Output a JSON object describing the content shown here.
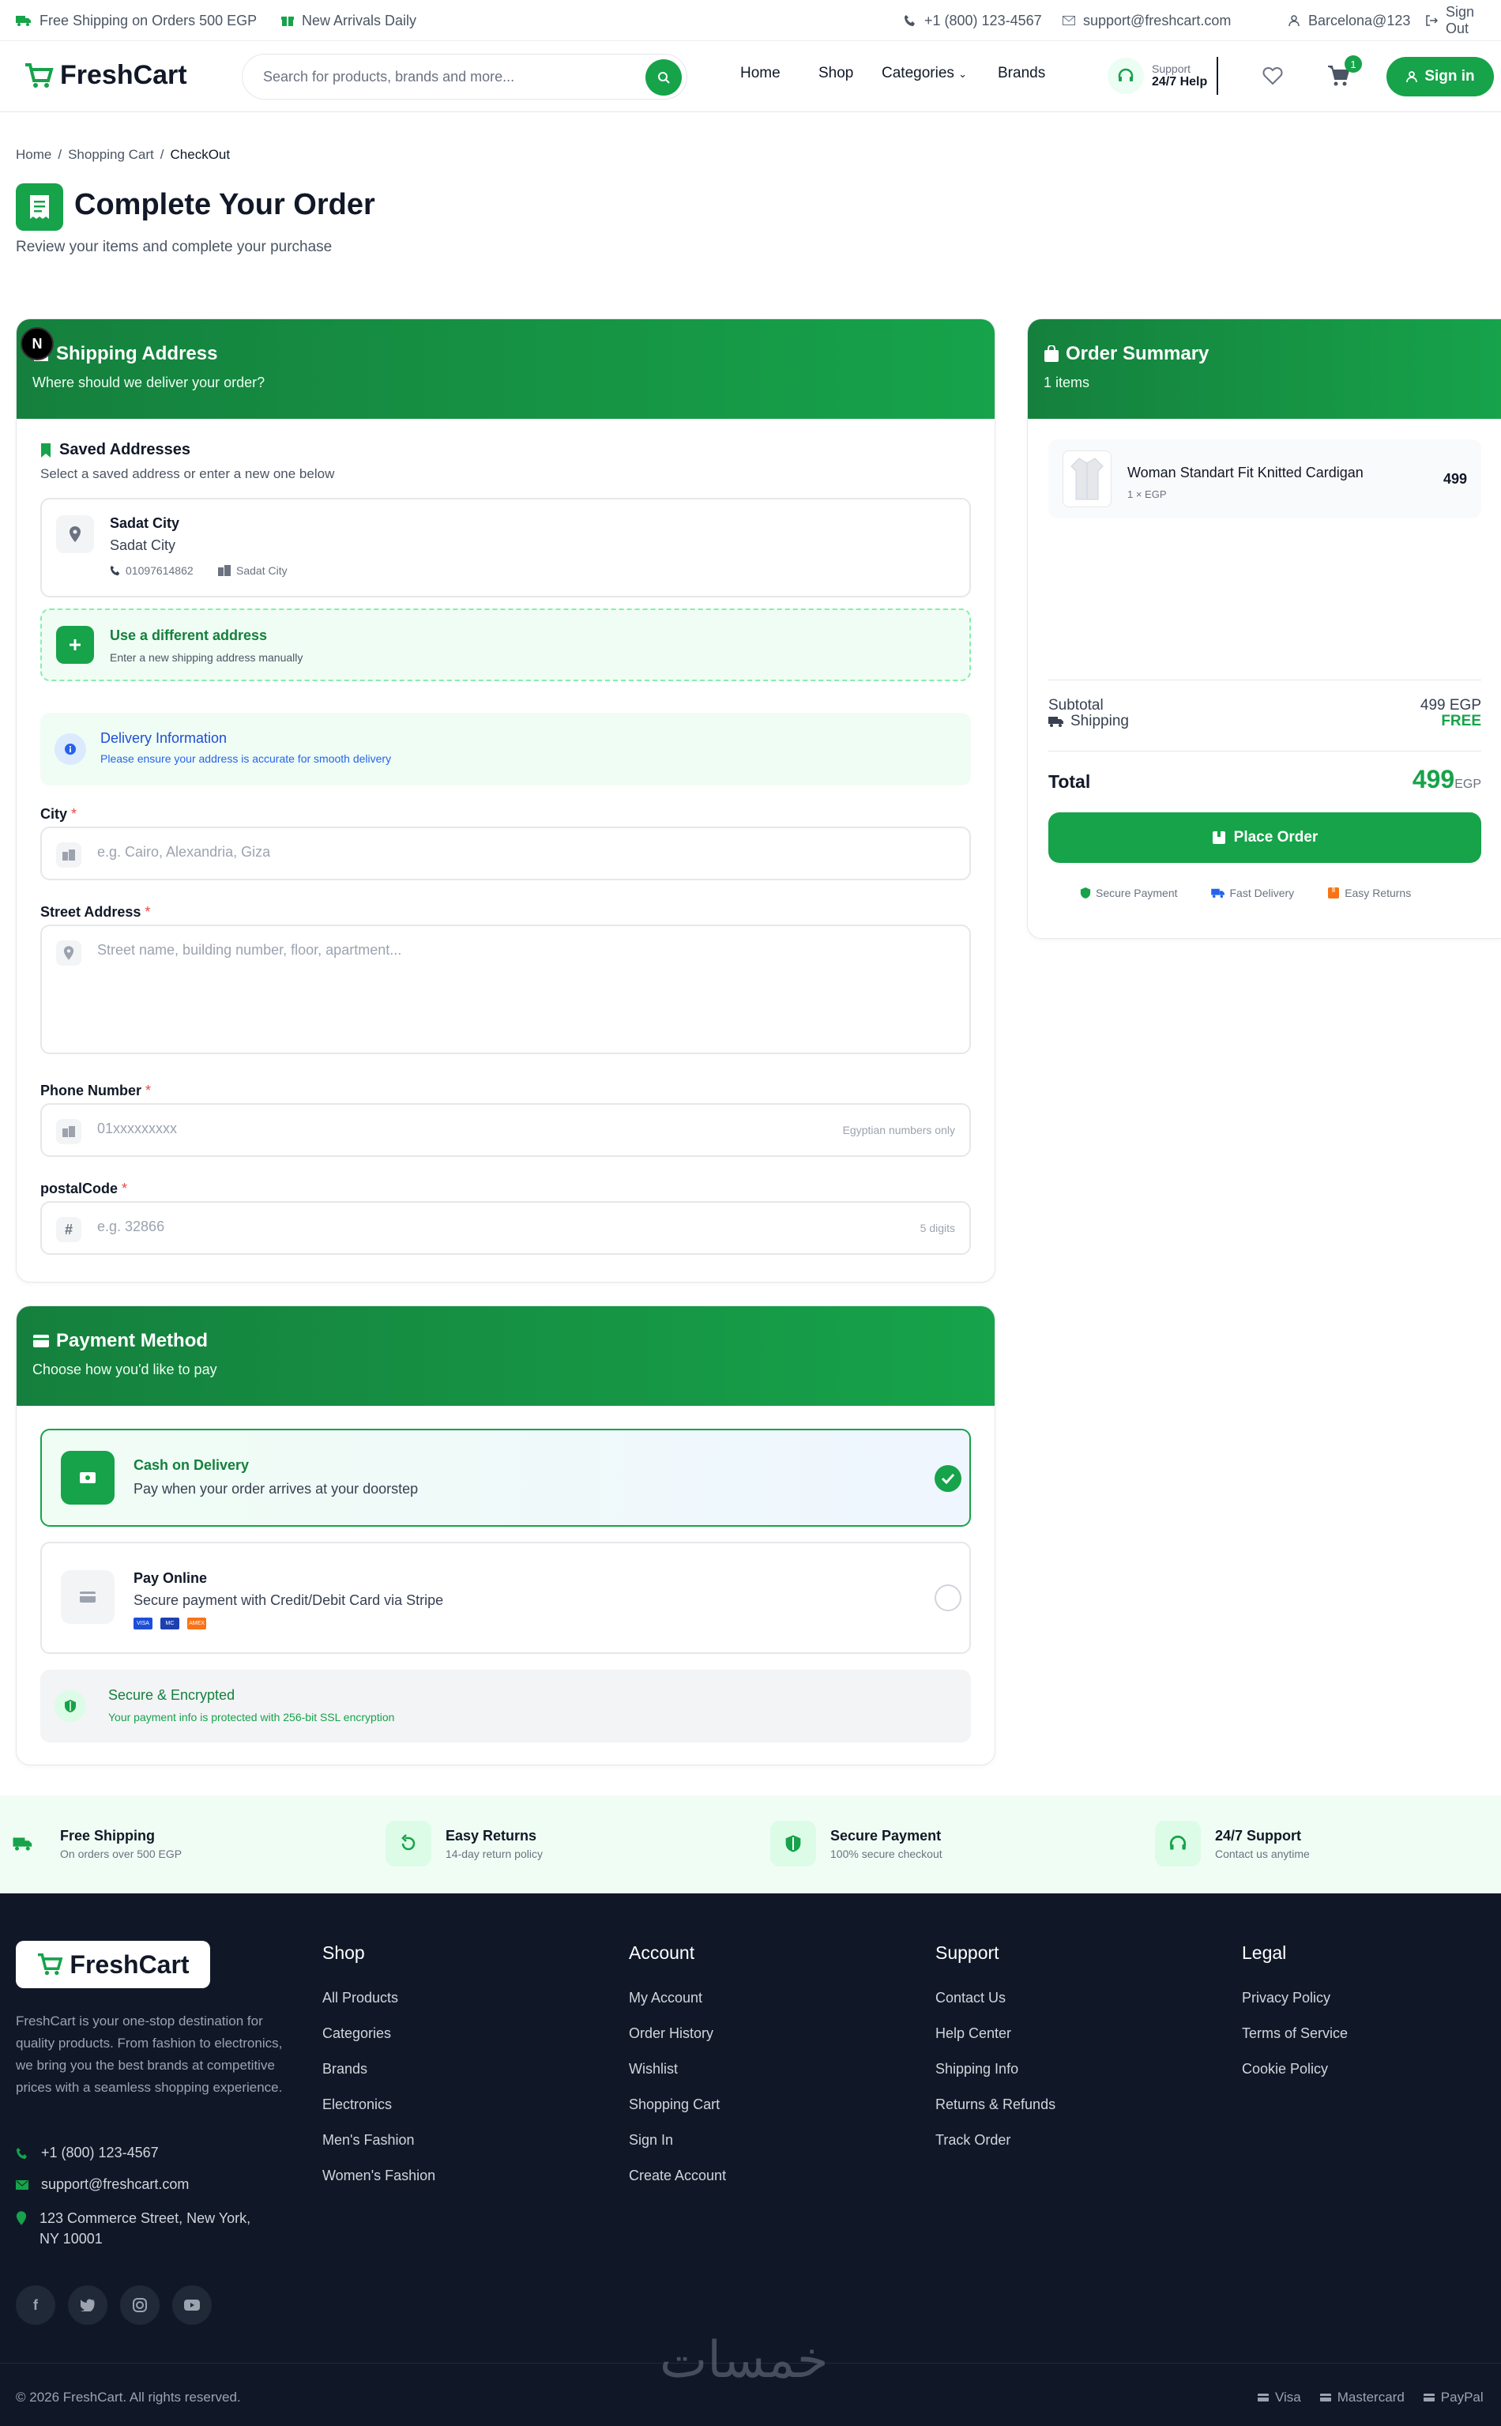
{
  "topbar": {
    "free_shipping": "Free Shipping on Orders 500 EGP",
    "new_arrivals": "New Arrivals Daily",
    "phone": "+1 (800) 123-4567",
    "email": "support@freshcart.com",
    "user": "Barcelona@123",
    "sign_out": "Sign Out"
  },
  "nav": {
    "logo": "FreshCart",
    "search_placeholder": "Search for products, brands and more...",
    "links": [
      "Home",
      "Shop",
      "Categories",
      "Brands"
    ],
    "support_label": "Support",
    "support_value": "24/7 Help",
    "cart_count": "1",
    "sign_in": "Sign in"
  },
  "breadcrumb": [
    "Home",
    "Shopping Cart",
    "CheckOut"
  ],
  "page": {
    "title": "Complete Your Order",
    "subtitle": "Review your items and complete your purchase"
  },
  "shipping": {
    "title": "Shipping Address",
    "subtitle": "Where should we deliver your order?",
    "saved_title": "Saved Addresses",
    "saved_sub": "Select a saved address or enter a new one below",
    "saved_address": {
      "name": "Sadat City",
      "line": "Sadat City",
      "phone": "01097614862",
      "city": "Sadat City"
    },
    "different_title": "Use a different address",
    "different_sub": "Enter a new shipping address manually",
    "delivery_title": "Delivery Information",
    "delivery_sub": "Please ensure your address is accurate for smooth delivery",
    "city_label": "City",
    "city_placeholder": "e.g. Cairo, Alexandria, Giza",
    "street_label": "Street Address",
    "street_placeholder": "Street name, building number, floor, apartment...",
    "phone_label": "Phone Number",
    "phone_placeholder": "01xxxxxxxxx",
    "phone_hint": "Egyptian numbers only",
    "postal_label": "postalCode",
    "postal_placeholder": "e.g. 32866",
    "postal_hint": "5 digits",
    "required_mark": "*"
  },
  "payment": {
    "title": "Payment Method",
    "subtitle": "Choose how you'd like to pay",
    "cod_title": "Cash on Delivery",
    "cod_sub": "Pay when your order arrives at your doorstep",
    "online_title": "Pay Online",
    "online_sub": "Secure payment with Credit/Debit Card via Stripe",
    "card_brands": [
      "VISA",
      "MC",
      "AMEX"
    ],
    "secure_title": "Secure & Encrypted",
    "secure_sub": "Your payment info is protected with 256-bit SSL encryption"
  },
  "summary": {
    "title": "Order Summary",
    "count": "1 items",
    "item_name": "Woman Standart Fit Knitted Cardigan",
    "item_qty": "1 × EGP",
    "item_price": "499",
    "subtotal_label": "Subtotal",
    "subtotal_value": "499 EGP",
    "shipping_label": "Shipping",
    "shipping_value": "FREE",
    "total_label": "Total",
    "total_value": "499",
    "total_currency": "EGP",
    "place_order": "Place Order",
    "trust": [
      "Secure Payment",
      "Fast Delivery",
      "Easy Returns"
    ]
  },
  "features": [
    {
      "title": "Free Shipping",
      "sub": "On orders over 500 EGP"
    },
    {
      "title": "Easy Returns",
      "sub": "14-day return policy"
    },
    {
      "title": "Secure Payment",
      "sub": "100% secure checkout"
    },
    {
      "title": "24/7 Support",
      "sub": "Contact us anytime"
    }
  ],
  "footer": {
    "logo": "FreshCart",
    "about": "FreshCart is your one-stop destination for quality products. From fashion to electronics, we bring you the best brands at competitive prices with a seamless shopping experience.",
    "phone": "+1 (800) 123-4567",
    "email": "support@freshcart.com",
    "address": "123 Commerce Street, New York, NY 10001",
    "columns": [
      {
        "title": "Shop",
        "links": [
          "All Products",
          "Categories",
          "Brands",
          "Electronics",
          "Men's Fashion",
          "Women's Fashion"
        ]
      },
      {
        "title": "Account",
        "links": [
          "My Account",
          "Order History",
          "Wishlist",
          "Shopping Cart",
          "Sign In",
          "Create Account"
        ]
      },
      {
        "title": "Support",
        "links": [
          "Contact Us",
          "Help Center",
          "Shipping Info",
          "Returns & Refunds",
          "Track Order"
        ]
      },
      {
        "title": "Legal",
        "links": [
          "Privacy Policy",
          "Terms of Service",
          "Cookie Policy"
        ]
      }
    ],
    "copyright": "© 2026 FreshCart. All rights reserved.",
    "watermark": "خمسات",
    "pay_methods": [
      "Visa",
      "Mastercard",
      "PayPal"
    ]
  },
  "colors": {
    "brand": "#16a34a",
    "footer_bg": "#101828",
    "features_bg": "#f0fdf4"
  }
}
